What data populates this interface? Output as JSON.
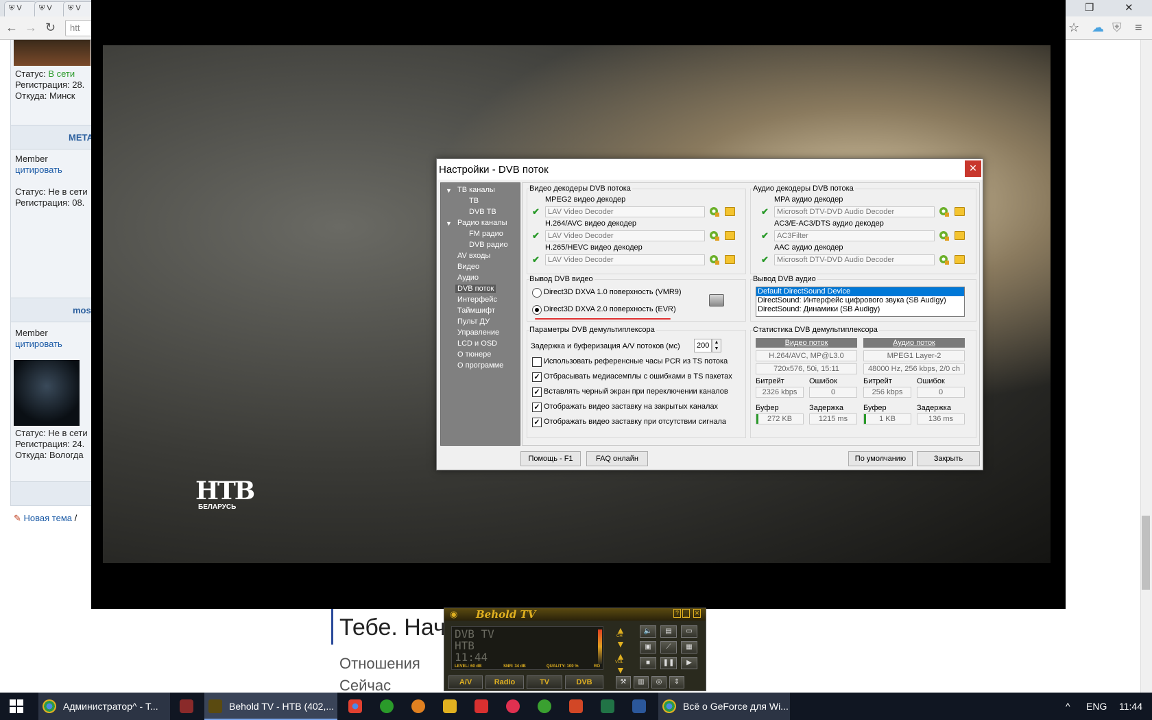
{
  "browser": {
    "tabs": [
      "V",
      "V",
      "V"
    ],
    "url": "htt",
    "controls": {
      "back": "←",
      "forward": "→",
      "reload": "↻",
      "restore": "❐",
      "close": "✕",
      "star": "☆",
      "menu": "≡"
    }
  },
  "forum": {
    "user1": {
      "status_label": "Статус:",
      "status_value": "В сети",
      "reg": "Регистрация: 28.",
      "from": "Откуда: Минск"
    },
    "sep_name1": "МЕТА",
    "user2": {
      "role": "Member",
      "quote": "цитировать",
      "status": "Статус: Не в сети",
      "reg": "Регистрация: 08."
    },
    "sep_name2": "mos",
    "user3": {
      "role": "Member",
      "quote": "цитировать",
      "status": "Статус: Не в сети",
      "reg": "Регистрация: 24.",
      "from": "Откуда: Вологда"
    },
    "new_topic": "Новая тема",
    "new_topic_sep": "/"
  },
  "article": {
    "title": "Тебе. Нач",
    "sub1": "Отношения",
    "sub2": "Сейчас"
  },
  "video": {
    "logo": "НТВ",
    "logo_sub": "БЕЛАРУСЬ"
  },
  "dialog": {
    "title": "Настройки - DVB поток",
    "close": "✕",
    "nav": {
      "tv_channels": "ТВ каналы",
      "tv": "ТВ",
      "dvb_tv": "DVB ТВ",
      "radio_channels": "Радио каналы",
      "fm_radio": "FM радио",
      "dvb_radio": "DVB радио",
      "av_inputs": "AV входы",
      "video": "Видео",
      "audio": "Аудио",
      "dvb_stream": "DVB поток",
      "interface": "Интерфейс",
      "timeshift": "Таймшифт",
      "remote": "Пульт ДУ",
      "control": "Управление",
      "lcd_osd": "LCD и OSD",
      "about_tuner": "О тюнере",
      "about_program": "О программе"
    },
    "video_decoders": {
      "title": "Видео декодеры DVB потока",
      "mpeg2_label": "MPEG2 видео декодер",
      "mpeg2_value": "LAV Video Decoder",
      "h264_label": "H.264/AVC видео декодер",
      "h264_value": "LAV Video Decoder",
      "h265_label": "H.265/HEVC видео декодер",
      "h265_value": "LAV Video Decoder"
    },
    "audio_decoders": {
      "title": "Аудио декодеры DVB потока",
      "mpa_label": "MPA аудио декодер",
      "mpa_value": "Microsoft DTV-DVD Audio Decoder",
      "ac3_label": "AC3/E-AC3/DTS аудио декодер",
      "ac3_value": "AC3Filter",
      "aac_label": "AAC аудио декодер",
      "aac_value": "Microsoft DTV-DVD Audio Decoder"
    },
    "video_output": {
      "title": "Вывод DVB видео",
      "opt1": "Direct3D DXVA 1.0 поверхность (VMR9)",
      "opt2": "Direct3D DXVA 2.0 поверхность (EVR)",
      "selected": 2
    },
    "audio_output": {
      "title": "Вывод DVB аудио",
      "items": [
        "Default DirectSound Device",
        "DirectSound: Интерфейс цифрового звука (SB Audigy)",
        "DirectSound: Динамики (SB Audigy)"
      ],
      "selected": 0
    },
    "demux_params": {
      "title": "Параметры DVB демультиплексора",
      "delay_label": "Задержка и буферизация A/V потоков (мс)",
      "delay_value": "200",
      "checks": [
        {
          "label": "Использовать референсные часы PCR из TS потока",
          "checked": false
        },
        {
          "label": "Отбрасывать медиасемплы с ошибками в TS пакетах",
          "checked": true
        },
        {
          "label": "Вставлять черный экран при переключении каналов",
          "checked": true
        },
        {
          "label": "Отображать видео заставку на закрытых каналах",
          "checked": true
        },
        {
          "label": "Отображать видео заставку при отсутствии сигнала",
          "checked": true
        }
      ]
    },
    "demux_stats": {
      "title": "Статистика DVB демультиплексора",
      "video_head": "Видео поток",
      "audio_head": "Аудио поток",
      "video_codec": "H.264/AVC, MP@L3.0",
      "video_format": "720x576, 50i, 15:11",
      "audio_codec": "MPEG1 Layer-2",
      "audio_format": "48000 Hz, 256 kbps, 2/0 ch",
      "bitrate_label": "Битрейт",
      "errors_label": "Ошибок",
      "buffer_label": "Буфер",
      "delay_label": "Задержка",
      "v_bitrate": "2326 kbps",
      "v_errors": "0",
      "v_buffer": "272 KB",
      "v_delay": "1215 ms",
      "a_bitrate": "256 kbps",
      "a_errors": "0",
      "a_buffer": "1 KB",
      "a_delay": "136 ms"
    },
    "buttons": {
      "help": "Помощь - F1",
      "faq": "FAQ онлайн",
      "defaults": "По умолчанию",
      "close": "Закрыть"
    }
  },
  "mini_player": {
    "title": "Behold TV",
    "lcd1": "DVB TV",
    "lcd2": "НТВ",
    "lcd3": "11:44",
    "level": "LEVEL: 60 dB",
    "snr": "SNR: 34 dB",
    "quality": "QUALITY: 100 %",
    "ro": "RO",
    "ch_label": "CH",
    "vol_label": "VOL",
    "buttons": [
      "A/V",
      "Radio",
      "TV",
      "DVB"
    ],
    "title_btns": [
      "?",
      "_",
      "□",
      "✕"
    ]
  },
  "taskbar": {
    "items": [
      "Администратор^ - Т...",
      "Behold TV - НТВ (402,...",
      "Всё о GeForce для Wi..."
    ],
    "lang": "ENG",
    "time": "11:44",
    "tray_chevron": "^"
  },
  "colors": {
    "accent": "#0078d7",
    "ok_green": "#2a9a2a",
    "close_red": "#c8372d",
    "behold_gold": "#e0b020"
  }
}
